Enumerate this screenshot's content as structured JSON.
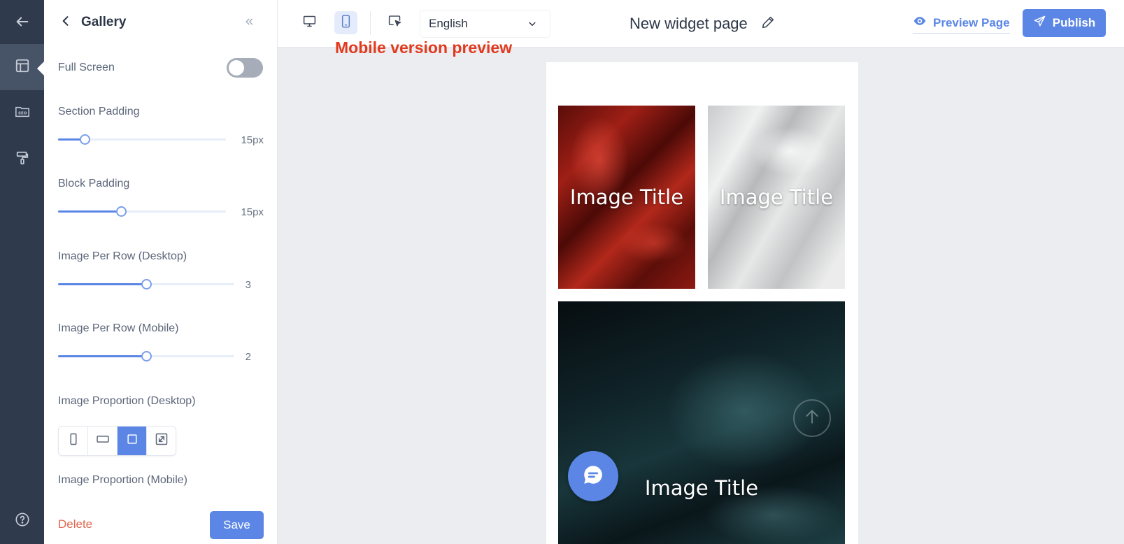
{
  "rail": {
    "items": [
      {
        "name": "back",
        "icon": "arrow-left-icon"
      },
      {
        "name": "layout",
        "icon": "layout-icon",
        "active": true
      },
      {
        "name": "seo",
        "icon": "seo-icon"
      },
      {
        "name": "theme",
        "icon": "paint-roller-icon"
      },
      {
        "name": "help",
        "icon": "help-circle-icon"
      }
    ]
  },
  "panel": {
    "title": "Gallery",
    "full_screen": {
      "label": "Full Screen",
      "enabled": false
    },
    "section_padding": {
      "label": "Section Padding",
      "value": "15px",
      "fraction": 0.16
    },
    "block_padding": {
      "label": "Block Padding",
      "value": "15px",
      "fraction": 0.375
    },
    "per_row_desktop": {
      "label": "Image Per Row (Desktop)",
      "value": "3",
      "fraction": 0.5
    },
    "per_row_mobile": {
      "label": "Image Per Row (Mobile)",
      "value": "2",
      "fraction": 0.5
    },
    "proportion_desktop": {
      "label": "Image Proportion (Desktop)",
      "options": [
        "portrait",
        "landscape",
        "square",
        "original"
      ],
      "selected": "square"
    },
    "proportion_mobile": {
      "label": "Image Proportion (Mobile)"
    },
    "delete_label": "Delete",
    "save_label": "Save"
  },
  "topbar": {
    "language": "English",
    "annotation": "Mobile version preview",
    "page_title": "New widget page",
    "preview_label": "Preview Page",
    "publish_label": "Publish"
  },
  "preview": {
    "tiles": [
      {
        "caption": "Image Title"
      },
      {
        "caption": "Image Title"
      },
      {
        "caption": "Image Title"
      }
    ]
  },
  "colors": {
    "accent": "#5b86e5",
    "rail": "#2f3a4d",
    "annotation": "#e23a1e",
    "delete": "#e0674f"
  }
}
